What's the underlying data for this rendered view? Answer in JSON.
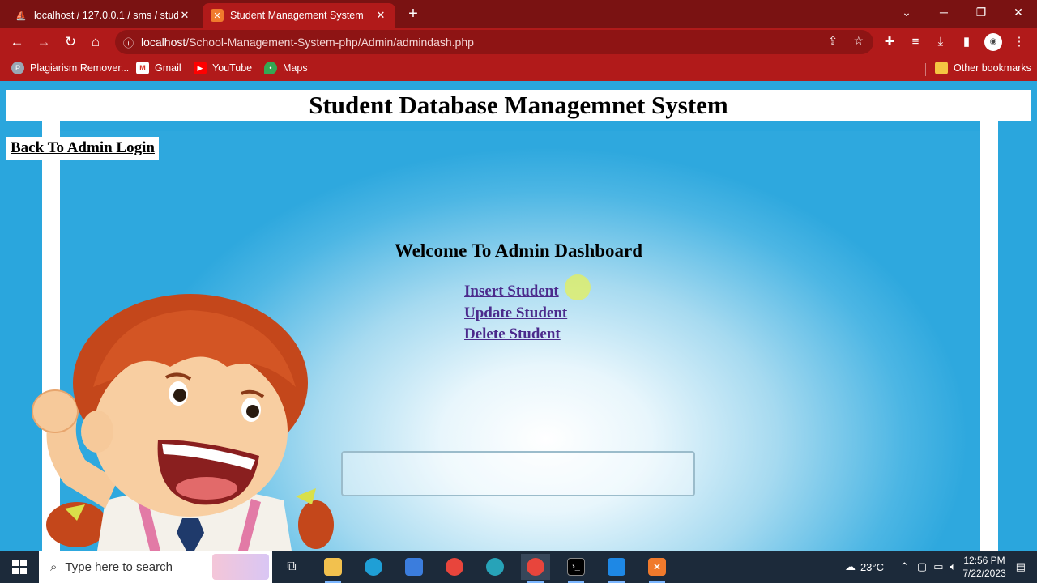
{
  "browser": {
    "tabs": [
      {
        "title": "localhost / 127.0.0.1 / sms / stude",
        "active": false
      },
      {
        "title": "Student Management System",
        "active": true
      }
    ],
    "url_host": "localhost",
    "url_path": "/School-Management-System-php/Admin/admindash.php",
    "bookmarks": [
      "Plagiarism Remover...",
      "Gmail",
      "YouTube",
      "Maps"
    ],
    "other_bookmarks": "Other bookmarks"
  },
  "page": {
    "title": "Student Database Managemnet System",
    "back_link": "Back To Admin Login",
    "welcome": "Welcome To Admin Dashboard",
    "links": [
      "Insert Student",
      "Update Student",
      "Delete Student"
    ]
  },
  "taskbar": {
    "search_placeholder": "Type here to search",
    "weather": "23°C",
    "time": "12:56 PM",
    "date": "7/22/2023"
  },
  "colors": {
    "chrome": "#b11a1a",
    "page_bg": "#2aa6dd",
    "link": "#4b2a8c"
  }
}
